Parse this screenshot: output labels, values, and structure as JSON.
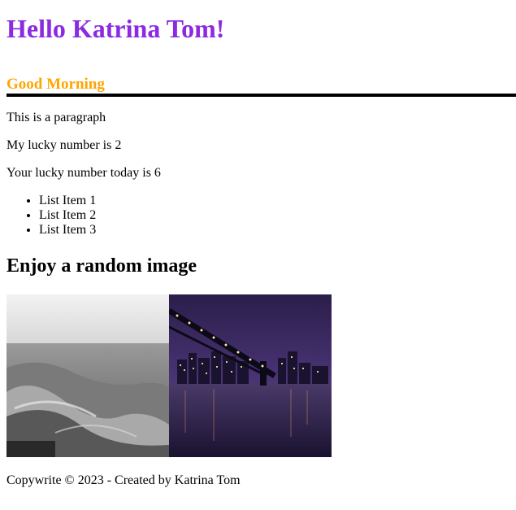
{
  "greeting": "Hello Katrina Tom!",
  "subgreeting": "Good Morning",
  "paragraphs": {
    "intro": "This is a paragraph",
    "lucky": "My lucky number is 2",
    "today": "Your lucky number today is 6"
  },
  "list": [
    "List Item 1",
    "List Item 2",
    "List Item 3"
  ],
  "image_heading": "Enjoy a random image",
  "footer": "Copywrite © 2023 - Created by Katrina Tom",
  "colors": {
    "greeting": "#8a2be2",
    "subgreeting": "#ffa500"
  },
  "images": [
    {
      "name": "ocean-waves-image"
    },
    {
      "name": "bridge-city-night-image"
    }
  ]
}
